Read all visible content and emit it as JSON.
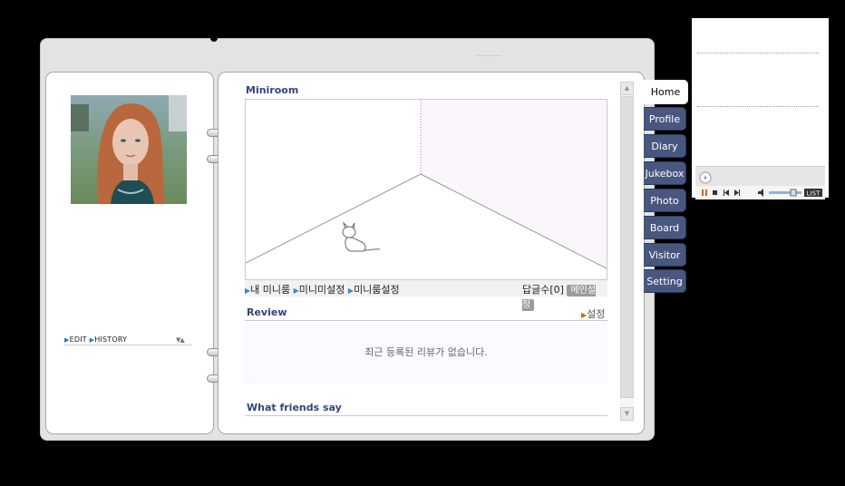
{
  "tabs": [
    {
      "label": "Home",
      "active": true
    },
    {
      "label": "Profile",
      "active": false
    },
    {
      "label": "Diary",
      "active": false
    },
    {
      "label": "Jukebox",
      "active": false
    },
    {
      "label": "Photo",
      "active": false
    },
    {
      "label": "Board",
      "active": false
    },
    {
      "label": "Visitor",
      "active": false
    },
    {
      "label": "Setting",
      "active": false
    }
  ],
  "left_page": {
    "edit_label": "EDIT",
    "history_label": "HISTORY"
  },
  "miniroom": {
    "title": "Miniroom",
    "links": [
      "내 미니룸",
      "미니미설정",
      "미니룸설정"
    ],
    "reply_count_label": "답글수[0]",
    "main_setting_label": "메인설정"
  },
  "review": {
    "title": "Review",
    "setting_label": "설정",
    "empty_message": "최근 등록된 리뷰가 없습니다."
  },
  "friends": {
    "title": "What friends say"
  },
  "jukebox_player": {
    "list_label": "LIST",
    "volume_fraction": 0.75
  },
  "colors": {
    "tab_bg": "#48577e",
    "section_title": "#33457a",
    "link_arrow": "#2b8fc6"
  },
  "icons": [
    "scroll-up-icon",
    "scroll-down-icon",
    "cat-minime-icon",
    "play-pause-icon",
    "stop-icon",
    "prev-icon",
    "next-icon",
    "volume-icon",
    "cd-icon"
  ]
}
